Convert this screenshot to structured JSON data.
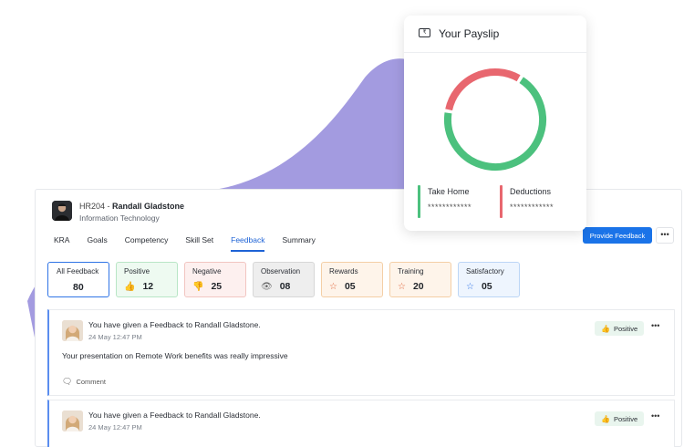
{
  "colors": {
    "blob": "#a39be0",
    "accent": "#1a73e8",
    "take_home": "#4cc17e",
    "deductions": "#e8676f"
  },
  "employee": {
    "id": "HR204",
    "separator": " - ",
    "name": "Randall Gladstone",
    "department": "Information Technology"
  },
  "tabs": [
    {
      "label": "KRA"
    },
    {
      "label": "Goals"
    },
    {
      "label": "Competency"
    },
    {
      "label": "Skill Set"
    },
    {
      "label": "Feedback",
      "active": true
    },
    {
      "label": "Summary"
    }
  ],
  "actions": {
    "provide_feedback": "Provide Feedback",
    "more": "•••"
  },
  "summary_cards": [
    {
      "label": "All Feedback",
      "count": "80",
      "icon": "none",
      "bg": "#ffffff",
      "border": "#2f74e6"
    },
    {
      "label": "Positive",
      "count": "12",
      "icon": "thumbs-up",
      "glyph": "👍",
      "bg": "#eefaf1",
      "border": "#b9e6c6"
    },
    {
      "label": "Negative",
      "count": "25",
      "icon": "thumbs-down",
      "glyph": "👎",
      "bg": "#fdf0ef",
      "border": "#f2c5c1"
    },
    {
      "label": "Observation",
      "count": "08",
      "icon": "eye",
      "glyph": "👁",
      "bg": "#eeeeee",
      "border": "#d7d7d7"
    },
    {
      "label": "Rewards",
      "count": "05",
      "icon": "star",
      "glyph": "☆",
      "bg": "#fef4ea",
      "border": "#f4cfa6"
    },
    {
      "label": "Training",
      "count": "20",
      "icon": "star",
      "glyph": "☆",
      "bg": "#fef4ea",
      "border": "#f4cfa6"
    },
    {
      "label": "Satisfactory",
      "count": "05",
      "icon": "star-blue",
      "glyph": "☆",
      "bg": "#eef5fe",
      "border": "#bcd6f6"
    }
  ],
  "feed": [
    {
      "title": "You have given a Feedback to Randall Gladstone.",
      "date": "24 May 12:47 PM",
      "message": "Your presentation on Remote Work benefits was really impressive",
      "badge": "Positive",
      "comment": "Comment",
      "more": "•••"
    },
    {
      "title": "You have given a Feedback to Randall Gladstone.",
      "date": "24 May 12:47 PM",
      "badge": "Positive",
      "more": "•••"
    }
  ],
  "payslip": {
    "title": "Your Payslip",
    "icon": "rupee-card-icon",
    "take_home_label": "Take Home",
    "take_home_value": "************",
    "deductions_label": "Deductions",
    "deductions_value": "************",
    "take_home_fraction": 0.69
  }
}
